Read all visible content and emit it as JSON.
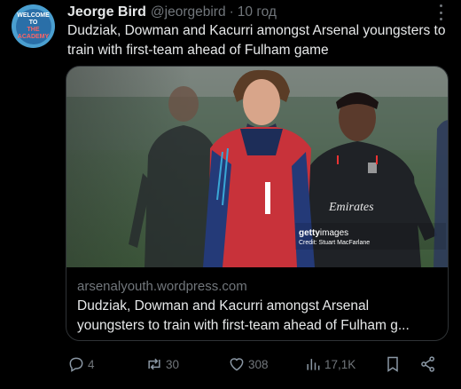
{
  "tweet": {
    "avatar_text": [
      "WELCOME TO",
      "THE ACADEMY"
    ],
    "author_name": "Jeorge Bird",
    "author_handle": "@jeorgebird",
    "separator": "·",
    "timestamp": "10 год",
    "text": "Dudziak, Dowman and  Kacurri amongst Arsenal youngsters to train with first-team ahead of Fulham game"
  },
  "card": {
    "image_credit_brand": "getty",
    "image_credit_brand_suffix": "images",
    "image_credit": "Credit: Stuart MacFarlane",
    "jersey_text": "Emirates",
    "domain": "arsenalyouth.wordpress.com",
    "title": "Dudziak, Dowman and Kacurri amongst Arsenal youngsters to train with first-team ahead of Fulham g..."
  },
  "actions": {
    "replies": "4",
    "reposts": "30",
    "likes": "308",
    "views": "17,1K"
  },
  "icons": [
    "more-icon",
    "reply-icon",
    "repost-icon",
    "like-icon",
    "views-icon",
    "bookmark-icon",
    "share-icon"
  ]
}
